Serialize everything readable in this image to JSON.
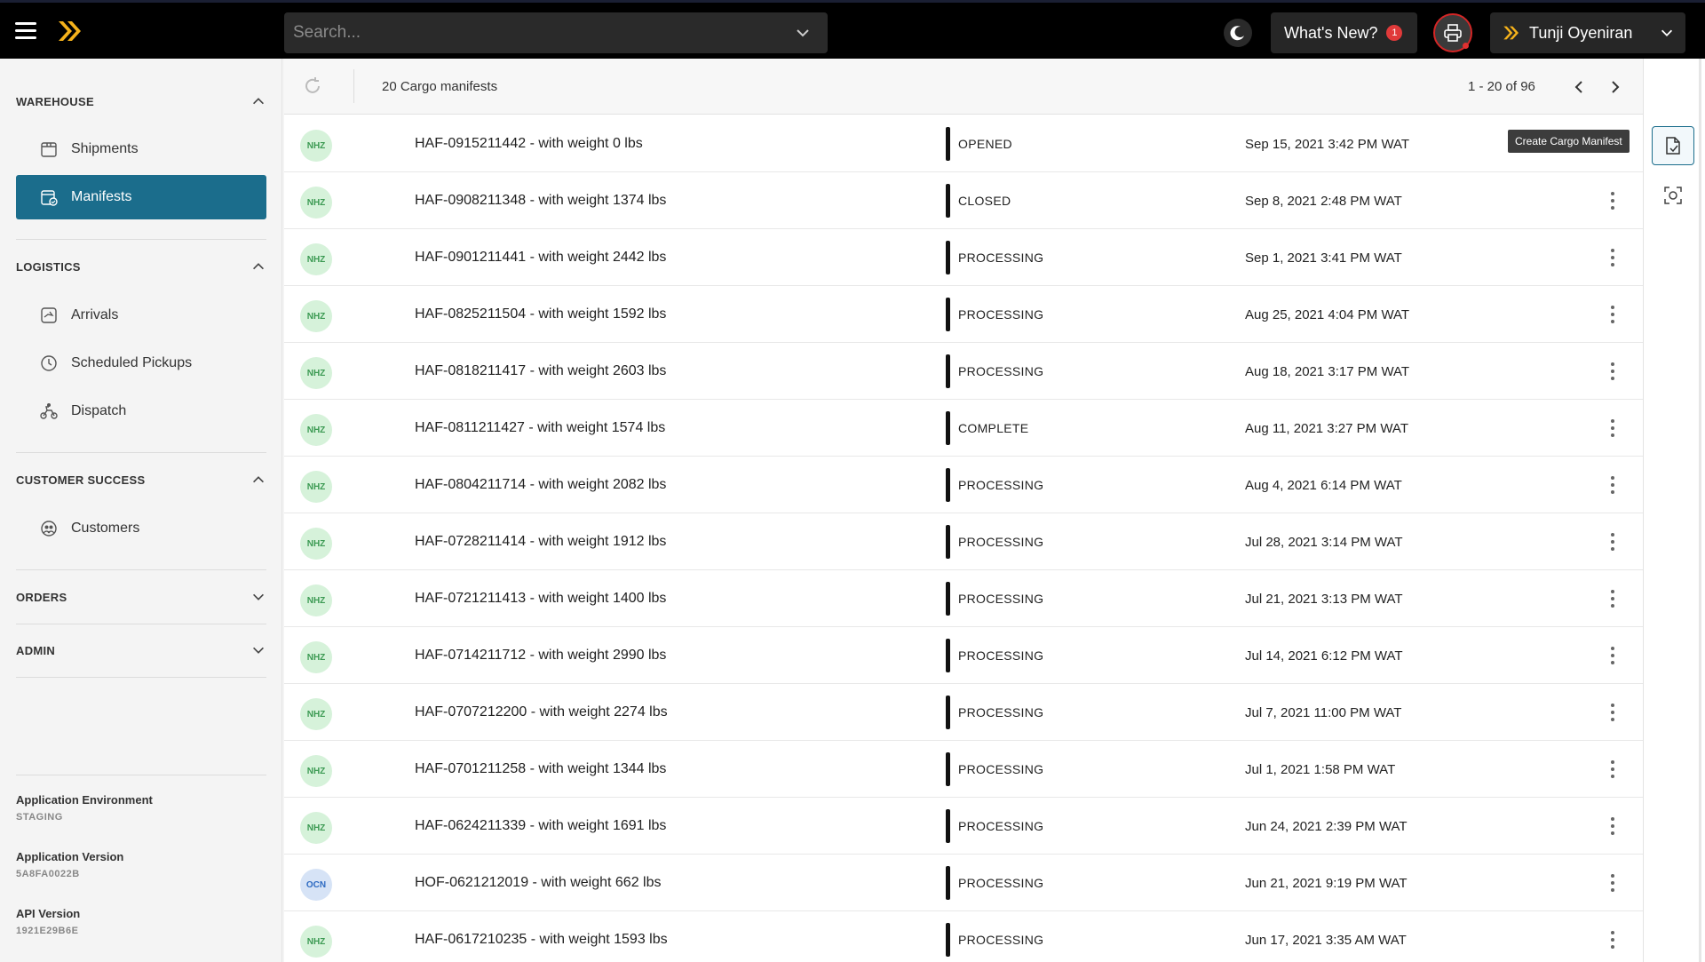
{
  "topbar": {
    "search_placeholder": "Search...",
    "whats_new_label": "What's New?",
    "whats_new_count": "1",
    "user_name": "Tunji Oyeniran"
  },
  "sidebar": {
    "warehouse": {
      "title": "WAREHOUSE",
      "items": [
        {
          "label": "Shipments"
        },
        {
          "label": "Manifests"
        }
      ]
    },
    "logistics": {
      "title": "LOGISTICS",
      "items": [
        {
          "label": "Arrivals"
        },
        {
          "label": "Scheduled Pickups"
        },
        {
          "label": "Dispatch"
        }
      ]
    },
    "customer_success": {
      "title": "CUSTOMER SUCCESS",
      "items": [
        {
          "label": "Customers"
        }
      ]
    },
    "orders": {
      "title": "ORDERS"
    },
    "admin": {
      "title": "ADMIN"
    },
    "env": {
      "app_env_label": "Application Environment",
      "app_env_value": "STAGING",
      "app_version_label": "Application Version",
      "app_version_value": "5A8FA0022B",
      "api_version_label": "API Version",
      "api_version_value": "1921E29B6E"
    }
  },
  "list": {
    "count_label": "20 Cargo manifests",
    "pager_label": "1 - 20 of 96",
    "tooltip": "Create Cargo Manifest",
    "rows": [
      {
        "avatar": "NHZ",
        "title": "HAF-0915211442 - with weight 0 lbs",
        "status": "OPENED",
        "date": "Sep 15, 2021 3:42 PM WAT"
      },
      {
        "avatar": "NHZ",
        "title": "HAF-0908211348 - with weight 1374 lbs",
        "status": "CLOSED",
        "date": "Sep 8, 2021 2:48 PM WAT"
      },
      {
        "avatar": "NHZ",
        "title": "HAF-0901211441 - with weight 2442 lbs",
        "status": "PROCESSING",
        "date": "Sep 1, 2021 3:41 PM WAT"
      },
      {
        "avatar": "NHZ",
        "title": "HAF-0825211504 - with weight 1592 lbs",
        "status": "PROCESSING",
        "date": "Aug 25, 2021 4:04 PM WAT"
      },
      {
        "avatar": "NHZ",
        "title": "HAF-0818211417 - with weight 2603 lbs",
        "status": "PROCESSING",
        "date": "Aug 18, 2021 3:17 PM WAT"
      },
      {
        "avatar": "NHZ",
        "title": "HAF-0811211427 - with weight 1574 lbs",
        "status": "COMPLETE",
        "date": "Aug 11, 2021 3:27 PM WAT"
      },
      {
        "avatar": "NHZ",
        "title": "HAF-0804211714 - with weight 2082 lbs",
        "status": "PROCESSING",
        "date": "Aug 4, 2021 6:14 PM WAT"
      },
      {
        "avatar": "NHZ",
        "title": "HAF-0728211414 - with weight 1912 lbs",
        "status": "PROCESSING",
        "date": "Jul 28, 2021 3:14 PM WAT"
      },
      {
        "avatar": "NHZ",
        "title": "HAF-0721211413 - with weight 1400 lbs",
        "status": "PROCESSING",
        "date": "Jul 21, 2021 3:13 PM WAT"
      },
      {
        "avatar": "NHZ",
        "title": "HAF-0714211712 - with weight 2990 lbs",
        "status": "PROCESSING",
        "date": "Jul 14, 2021 6:12 PM WAT"
      },
      {
        "avatar": "NHZ",
        "title": "HAF-0707212200 - with weight 2274 lbs",
        "status": "PROCESSING",
        "date": "Jul 7, 2021 11:00 PM WAT"
      },
      {
        "avatar": "NHZ",
        "title": "HAF-0701211258 - with weight 1344 lbs",
        "status": "PROCESSING",
        "date": "Jul 1, 2021 1:58 PM WAT"
      },
      {
        "avatar": "NHZ",
        "title": "HAF-0624211339 - with weight 1691 lbs",
        "status": "PROCESSING",
        "date": "Jun 24, 2021 2:39 PM WAT"
      },
      {
        "avatar": "OCN",
        "title": "HOF-0621212019 - with weight 662 lbs",
        "status": "PROCESSING",
        "date": "Jun 21, 2021 9:19 PM WAT"
      },
      {
        "avatar": "NHZ",
        "title": "HAF-0617210235 - with weight 1593 lbs",
        "status": "PROCESSING",
        "date": "Jun 17, 2021 3:35 AM WAT"
      }
    ]
  }
}
